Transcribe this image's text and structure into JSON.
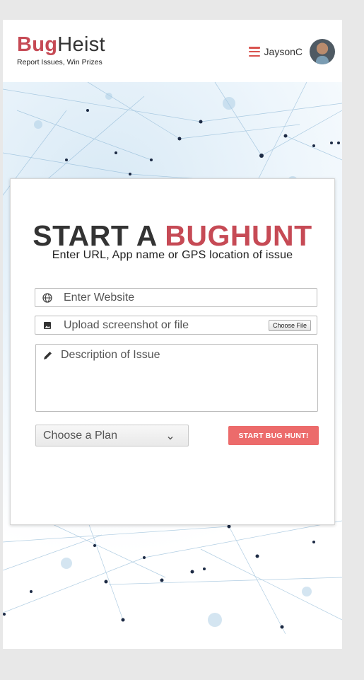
{
  "brand": {
    "logo_part1": "Bug",
    "logo_part2": "Heist",
    "tagline": "Report Issues, Win Prizes",
    "color_primary": "#c64a55",
    "color_dark": "#333333"
  },
  "user": {
    "menu_icon": "hamburger-menu-icon",
    "name": "JaysonC",
    "avatar_icon": "user-avatar"
  },
  "hero": {
    "title_part1": "START A ",
    "title_part2": "BUGHUNT",
    "subtitle": "Enter URL, App name or GPS location of issue"
  },
  "form": {
    "website": {
      "icon": "globe-icon",
      "placeholder": "Enter Website"
    },
    "upload": {
      "icon": "image-icon",
      "label": "Upload screenshot or file",
      "button": "Choose File"
    },
    "description": {
      "icon": "pencil-icon",
      "placeholder": "Description of Issue"
    },
    "plan": {
      "selected": "Choose a Plan",
      "icon": "chevron-down-icon"
    },
    "submit_label": "START BUG HUNT!",
    "submit_color": "#ec6b6b"
  }
}
